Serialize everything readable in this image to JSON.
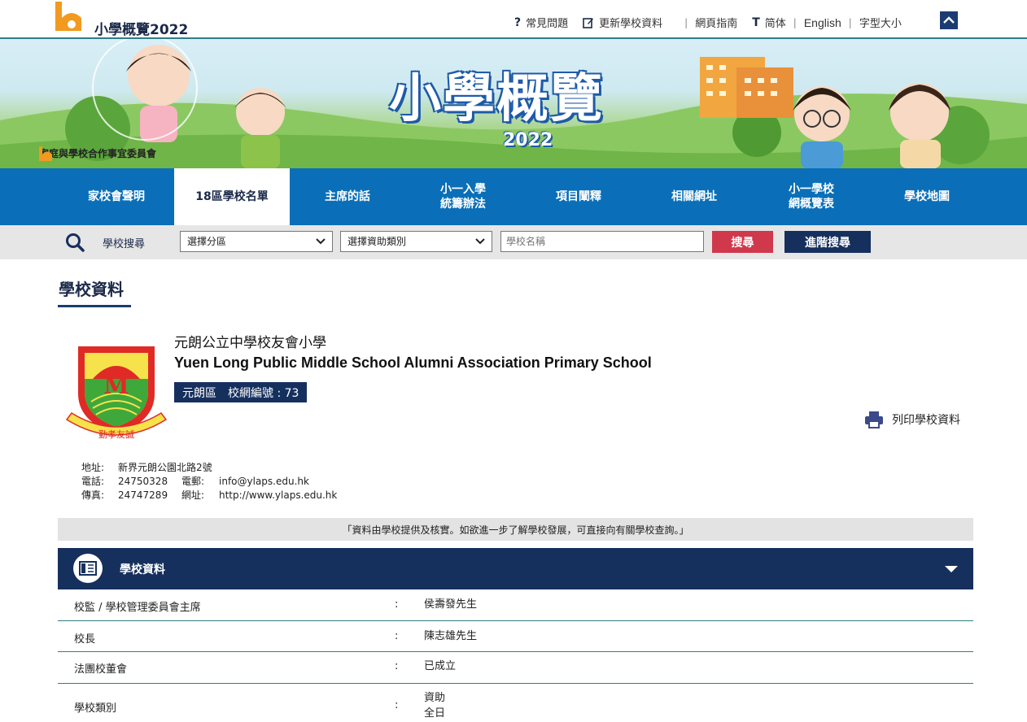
{
  "header": {
    "site_title": "小學概覽2022",
    "links": {
      "faq": "常見問題",
      "update": "更新學校資料",
      "guide": "網頁指南",
      "simplified": "简体",
      "english": "English",
      "font_size": "字型大小"
    }
  },
  "banner": {
    "title": "小學概覽",
    "year": "2022",
    "org": "家庭與學校合作事宜委員會"
  },
  "nav": {
    "items": [
      {
        "label": "家校會聲明"
      },
      {
        "label": "18區學校名單"
      },
      {
        "label": "主席的話"
      },
      {
        "label": "小一入學統籌辦法",
        "line1": "小一入學",
        "line2": "統籌辦法"
      },
      {
        "label": "項目闡釋"
      },
      {
        "label": "相關網址"
      },
      {
        "label": "小一學校網概覽表",
        "line1": "小一學校",
        "line2": "網概覽表"
      },
      {
        "label": "學校地圖"
      }
    ],
    "active_index": 1
  },
  "search": {
    "label": "學校搜尋",
    "district_select": "選擇分區",
    "finance_select": "選擇資助類別",
    "name_placeholder": "學校名稱",
    "search_button": "搜尋",
    "advanced_button": "進階搜尋"
  },
  "page": {
    "section_title": "學校資料"
  },
  "school": {
    "name_zh": "元朗公立中學校友會小學",
    "name_en": "Yuen Long Public Middle School Alumni Association Primary School",
    "district": "元朗區",
    "net_label": "校網編號 : 73",
    "print_label": "列印學校資料",
    "crest_motto": "勤孝友誠",
    "address_label": "地址:",
    "address": "新界元朗公園北路2號",
    "phone_label": "電話:",
    "phone": "24750328",
    "email_label": "電郵:",
    "email": "info@ylaps.edu.hk",
    "fax_label": "傳真:",
    "fax": "24747289",
    "website_label": "網址:",
    "website": "http://www.ylaps.edu.hk"
  },
  "notice": "「資料由學校提供及核實。如欲進一步了解學校發展，可直接向有關學校查詢。」",
  "panel": {
    "title": "學校資料",
    "rows": [
      {
        "key": "校監 / 學校管理委員會主席",
        "sep": ":",
        "value": "侯壽發先生"
      },
      {
        "key": "校長",
        "sep": ":",
        "value": "陳志雄先生"
      },
      {
        "key": "法團校董會",
        "sep": ":",
        "value": "已成立"
      },
      {
        "key": "學校類別",
        "sep": ":",
        "value1": "資助",
        "value2": "全日"
      }
    ]
  },
  "colors": {
    "nav_blue": "#0a6fb8",
    "dark_navy": "#16305e",
    "search_red": "#d0384b",
    "teal_line": "#2f7d86"
  }
}
